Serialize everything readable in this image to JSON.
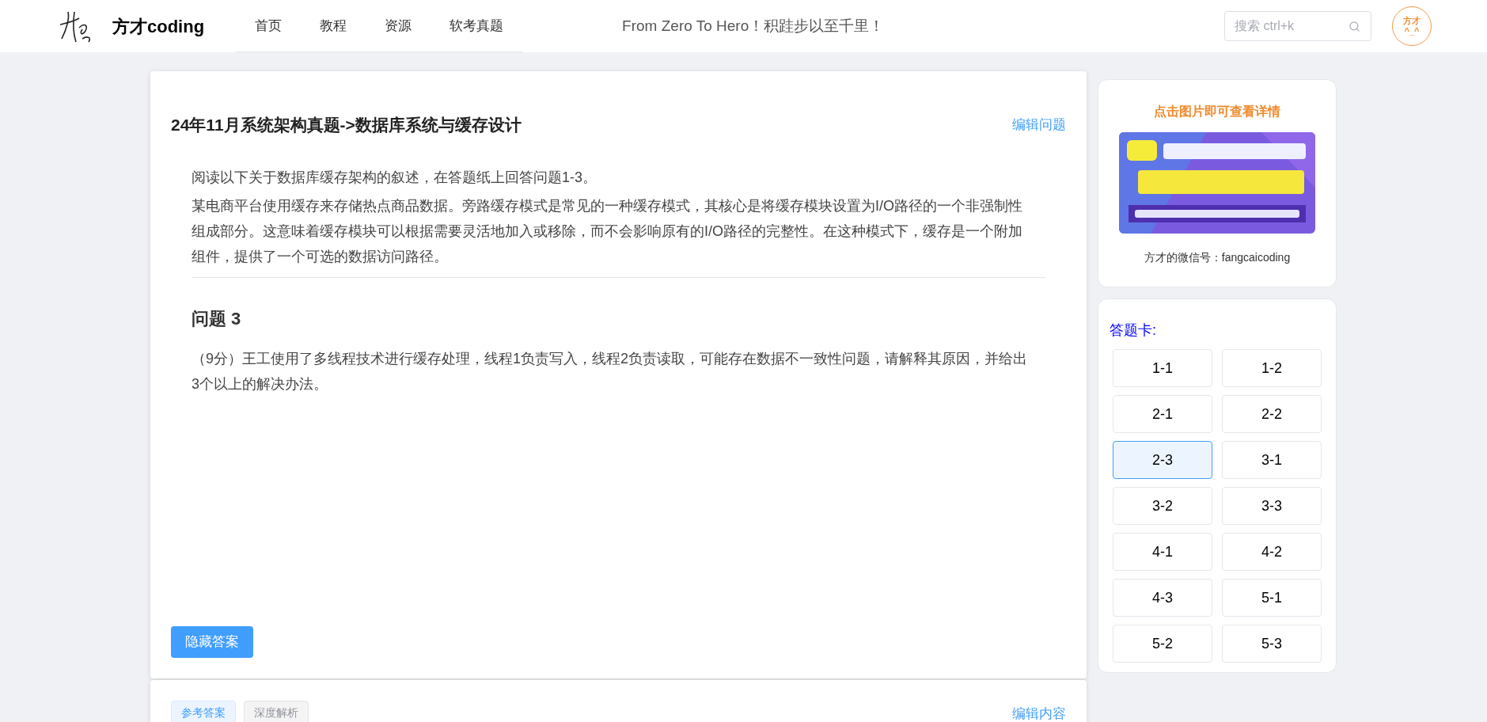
{
  "header": {
    "brand": "方才coding",
    "nav": [
      {
        "label": "首页"
      },
      {
        "label": "教程"
      },
      {
        "label": "资源"
      },
      {
        "label": "软考真题"
      }
    ],
    "motto": "From Zero To Hero！积跬步以至千里！",
    "search": {
      "placeholder": "搜索 ctrl+k"
    },
    "avatar": [
      "方才",
      "^_^"
    ]
  },
  "question": {
    "title": "24年11月系统架构真题->数据库系统与缓存设计",
    "edit_link": "编辑问题",
    "intro": "阅读以下关于数据库缓存架构的叙述，在答题纸上回答问题1-3。",
    "passage": "某电商平台使用缓存来存储热点商品数据。旁路缓存模式是常见的一种缓存模式，其核心是将缓存模块设置为I/O路径的一个非强制性组成部分。这意味着缓存模块可以根据需要灵活地加入或移除，而不会影响原有的I/O路径的完整性。在这种模式下，缓存是一个附加组件，提供了一个可选的数据访问路径。",
    "heading": "问题 3",
    "body": "（9分）王工使用了多线程技术进行缓存处理，线程1负责写入，线程2负责读取，可能存在数据不一致性问题，请解释其原因，并给出3个以上的解决办法。",
    "button": "隐藏答案"
  },
  "answer_panel": {
    "tabs": [
      {
        "label": "参考答案",
        "selected": true
      },
      {
        "label": "深度解析",
        "selected": false
      }
    ],
    "edit_link": "编辑内容"
  },
  "promo": {
    "caption": "点击图片即可查看详情",
    "wechat": "方才的微信号：fangcaicoding"
  },
  "answer_card": {
    "title": "答题卡:",
    "items": [
      {
        "label": "1-1",
        "selected": false
      },
      {
        "label": "1-2",
        "selected": false
      },
      {
        "label": "2-1",
        "selected": false
      },
      {
        "label": "2-2",
        "selected": false
      },
      {
        "label": "2-3",
        "selected": true
      },
      {
        "label": "3-1",
        "selected": false
      },
      {
        "label": "3-2",
        "selected": false
      },
      {
        "label": "3-3",
        "selected": false
      },
      {
        "label": "4-1",
        "selected": false
      },
      {
        "label": "4-2",
        "selected": false
      },
      {
        "label": "4-3",
        "selected": false
      },
      {
        "label": "5-1",
        "selected": false
      },
      {
        "label": "5-2",
        "selected": false
      },
      {
        "label": "5-3",
        "selected": false
      }
    ]
  }
}
